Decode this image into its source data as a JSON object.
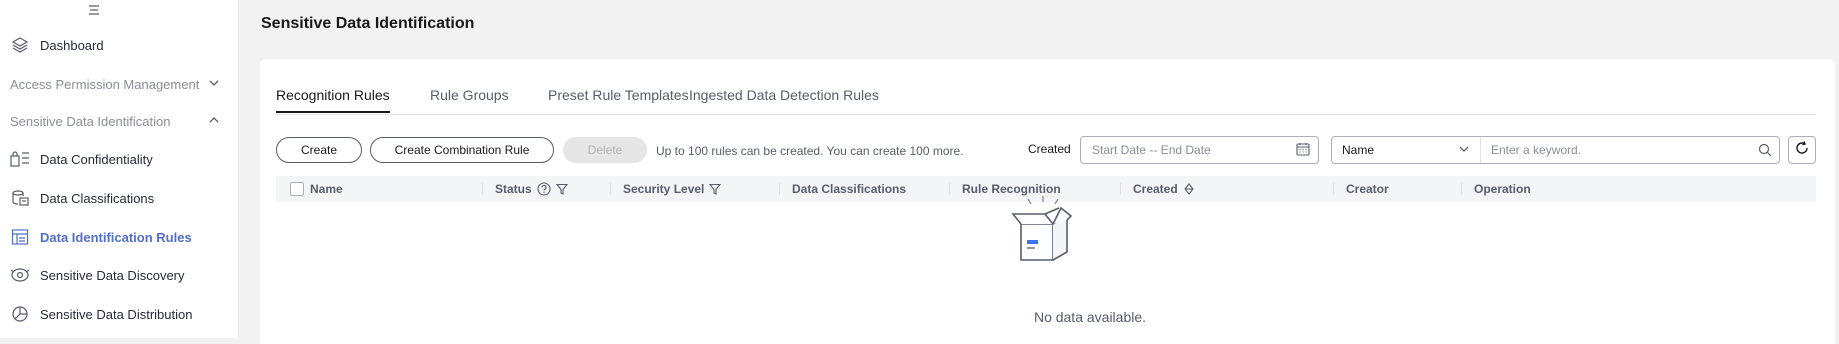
{
  "sidebar": {
    "menu_icon": "hamburger-icon",
    "items": [
      {
        "label": "Dashboard",
        "icon": "layers-icon"
      },
      {
        "label": "Access Permission Management",
        "icon": "chevron-down-icon"
      },
      {
        "label": "Sensitive Data Identification",
        "icon": "chevron-up-icon"
      },
      {
        "label": "Data Confidentiality",
        "icon": "confidentiality-icon"
      },
      {
        "label": "Data Classifications",
        "icon": "database-icon"
      },
      {
        "label": "Data Identification Rules",
        "icon": "rules-icon",
        "active": true
      },
      {
        "label": "Sensitive Data Discovery",
        "icon": "discovery-icon"
      },
      {
        "label": "Sensitive Data Distribution",
        "icon": "pie-chart-icon"
      }
    ],
    "active_color": "#526ecc"
  },
  "page": {
    "title": "Sensitive Data Identification"
  },
  "tabs": [
    {
      "label": "Recognition Rules",
      "active": true
    },
    {
      "label": "Rule Groups"
    },
    {
      "label": "Preset Rule Templates"
    },
    {
      "label": "Ingested Data Detection Rules"
    }
  ],
  "toolbar": {
    "create_label": "Create",
    "create_combination_label": "Create Combination Rule",
    "delete_label": "Delete",
    "hint": "Up to 100 rules can be created. You can create 100 more.",
    "created_label": "Created",
    "date_placeholder": "Start Date -- End Date",
    "search_field": "Name",
    "search_placeholder": "Enter a keyword."
  },
  "table": {
    "columns": [
      "Name",
      "Status",
      "Security Level",
      "Data Classifications",
      "Rule Recognition",
      "Created",
      "Creator",
      "Operation"
    ],
    "rows": [],
    "empty_text": "No data available."
  },
  "colors": {
    "accent": "#526ecc",
    "background": "#f2f2f2",
    "empty_icon_blue": "#3b74f0"
  }
}
